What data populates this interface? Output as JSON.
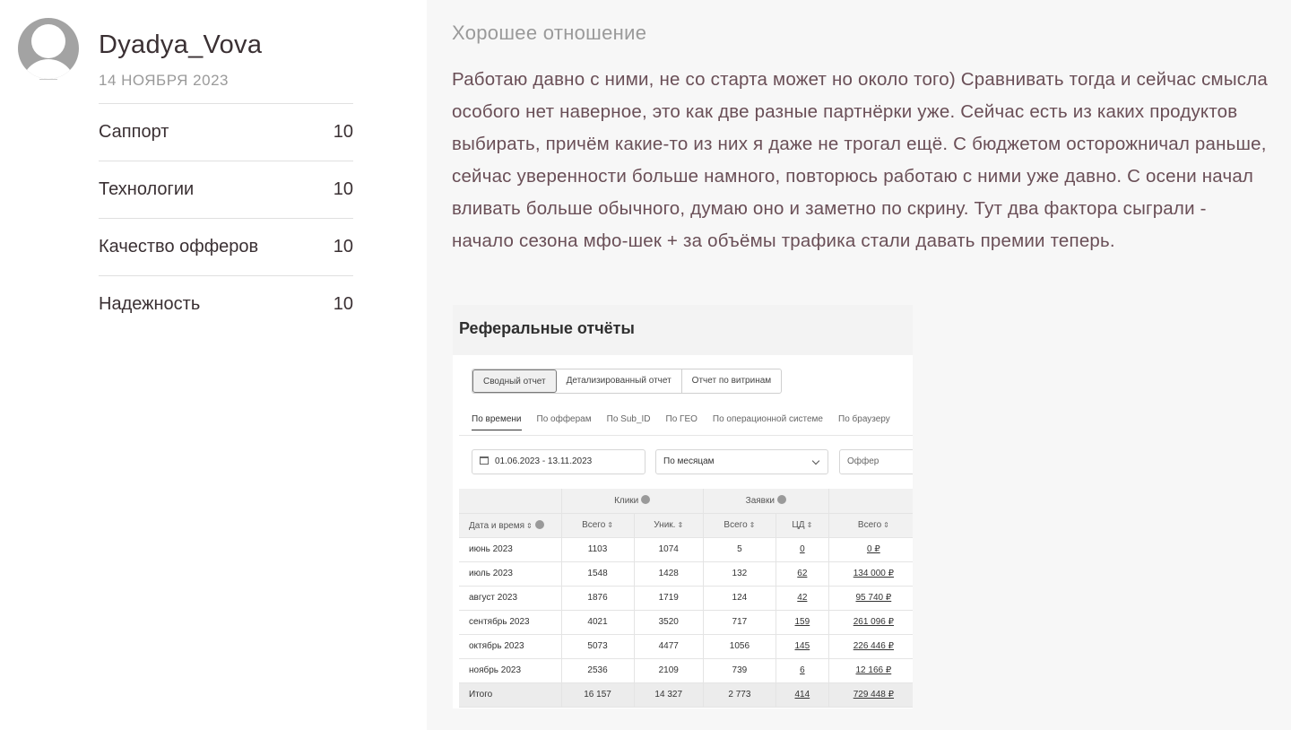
{
  "author": {
    "name": "Dyadya_Vova",
    "date": "14 НОЯБРЯ 2023"
  },
  "ratings": [
    {
      "label": "Саппорт",
      "value": "10"
    },
    {
      "label": "Технологии",
      "value": "10"
    },
    {
      "label": "Качество офферов",
      "value": "10"
    },
    {
      "label": "Надежность",
      "value": "10"
    }
  ],
  "review": {
    "title": "Хорошее отношение",
    "text": "Работаю давно с ними, не со старта может но около того) Сравнивать тогда и сейчас смысла особого нет наверное, это как две разные партнёрки уже. Сейчас есть из каких продуктов выбирать, причём какие-то из них я даже не трогал ещё. С бюджетом осторожничал раньше, сейчас уверенности больше намного, повторюсь работаю с ними уже давно.  С осени начал вливать больше обычного, думаю оно и заметно по скрину.  Тут два фактора сыграли - начало сезона мфо-шек + за объёмы трафика стали давать премии теперь."
  },
  "screenshot": {
    "title": "Реферальные отчёты",
    "report_tabs": [
      "Сводный отчет",
      "Детализированный отчет",
      "Отчет по витринам"
    ],
    "sub_tabs": [
      "По времени",
      "По офферам",
      "По Sub_ID",
      "По ГЕО",
      "По операционной системе",
      "По браузеру"
    ],
    "filters": {
      "date_range": "01.06.2023 - 13.11.2023",
      "grouping": "По месяцам",
      "offer_placeholder": "Оффер"
    },
    "group_headers": {
      "clicks": "Клики",
      "requests": "Заявки"
    },
    "columns": [
      "Дата и время",
      "Всего",
      "Уник.",
      "Всего",
      "ЦД",
      "Всего"
    ],
    "rows": [
      [
        "июнь 2023",
        "1103",
        "1074",
        "5",
        "0",
        "0 ₽"
      ],
      [
        "июль 2023",
        "1548",
        "1428",
        "132",
        "62",
        "134 000 ₽"
      ],
      [
        "август 2023",
        "1876",
        "1719",
        "124",
        "42",
        "95 740 ₽"
      ],
      [
        "сентябрь 2023",
        "4021",
        "3520",
        "717",
        "159",
        "261 096 ₽"
      ],
      [
        "октябрь 2023",
        "5073",
        "4477",
        "1056",
        "145",
        "226 446 ₽"
      ],
      [
        "ноябрь 2023",
        "2536",
        "2109",
        "739",
        "6",
        "12 166 ₽"
      ]
    ],
    "total": [
      "Итого",
      "16 157",
      "14 327",
      "2 773",
      "414",
      "729 448 ₽"
    ]
  },
  "colors": {
    "accent": "#7ac143",
    "text_body": "#6a4f57",
    "muted": "#9a9a9a"
  }
}
